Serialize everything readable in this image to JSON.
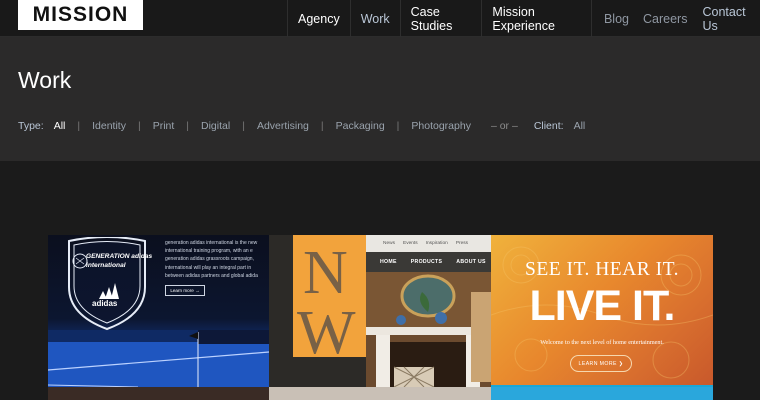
{
  "header": {
    "logo": "MISSION",
    "nav": [
      {
        "label": "Agency",
        "state": "normal"
      },
      {
        "label": "Work",
        "state": "active"
      },
      {
        "label": "Case Studies",
        "state": "normal"
      },
      {
        "label": "Mission Experience",
        "state": "normal"
      }
    ],
    "secondary_nav": [
      {
        "label": "Blog"
      },
      {
        "label": "Careers"
      },
      {
        "label": "Contact Us"
      }
    ]
  },
  "page": {
    "title": "Work"
  },
  "filters": {
    "type_label": "Type:",
    "types": [
      "All",
      "Identity",
      "Print",
      "Digital",
      "Advertising",
      "Packaging",
      "Photography"
    ],
    "active_type": "All",
    "or_label": "– or –",
    "client_label": "Client:",
    "client_value": "All"
  },
  "portfolio": {
    "tile_adidas": {
      "brand_line1": "GENERATION adidas",
      "brand_line2": "international",
      "brand_mark": "adidas",
      "copy_lines": [
        "generation adidas international is the new",
        "international training program, with an e",
        "generation adidas grassroots campaign,",
        "international will play an integral part in",
        "between adidas partners and global adida"
      ],
      "learn_more": "Learn more →"
    },
    "tile_nw": {
      "top_links": [
        "News",
        "Events",
        "Inspiration",
        "Press"
      ],
      "menu": [
        "HOME",
        "PRODUCTS",
        "ABOUT US"
      ],
      "logo_letters": "NW"
    },
    "tile_live": {
      "headline1": "SEE IT. HEAR IT.",
      "headline2": "LIVE IT.",
      "welcome": "Welcome to the next level of home entertainment.",
      "cta": "LEARN MORE ❯"
    }
  },
  "colors": {
    "accent": "#b9c6d6",
    "band": "#2b2a2a",
    "background": "#1b1b1b",
    "tile_orange": "#e8882d"
  }
}
